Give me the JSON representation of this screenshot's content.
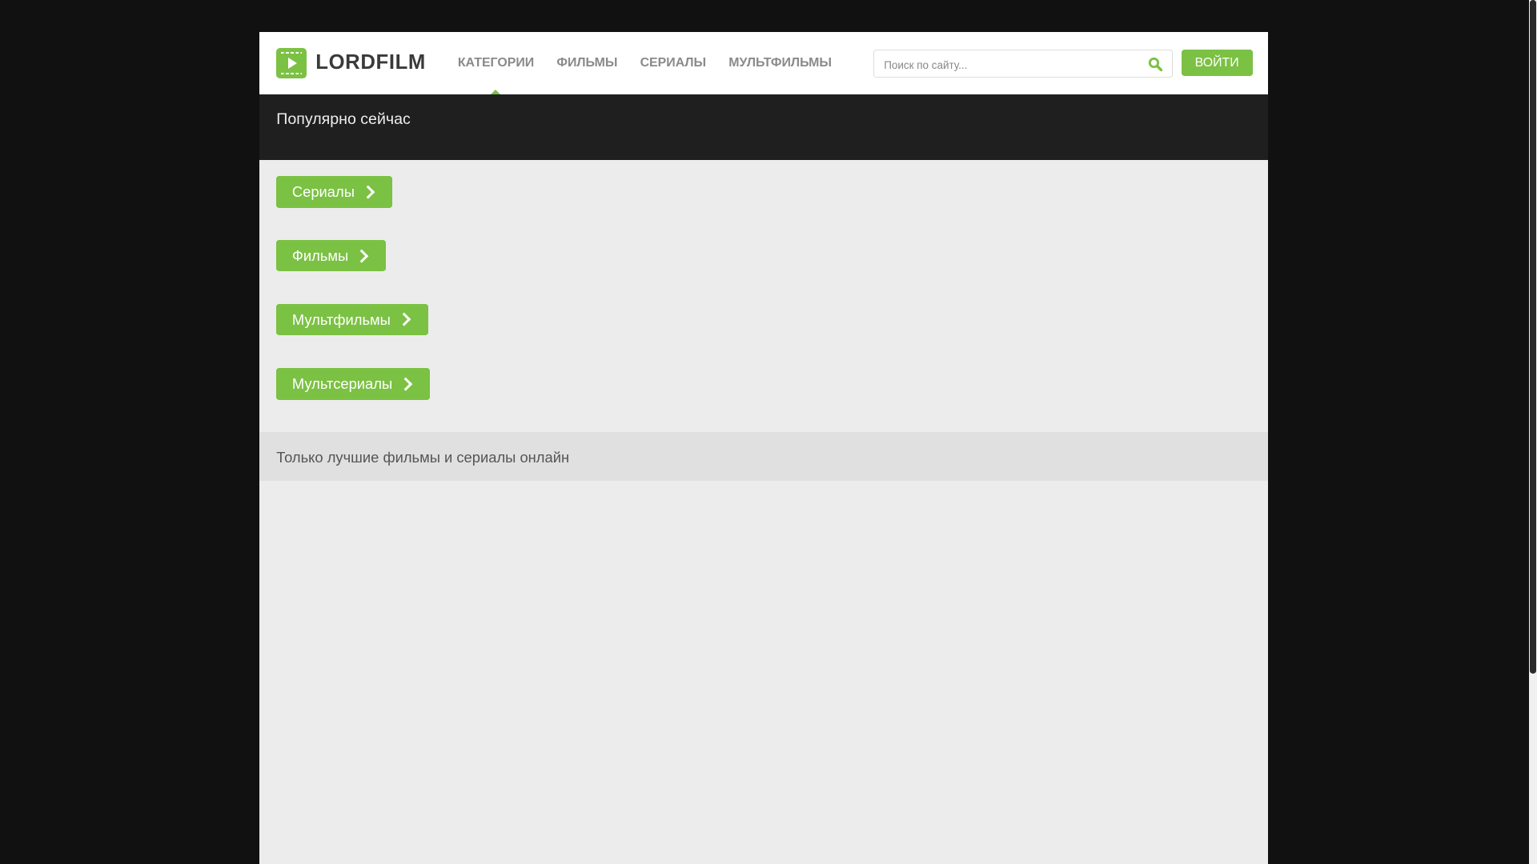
{
  "header": {
    "logo": "LORDFILM",
    "nav": [
      "КАТЕГОРИИ",
      "ФИЛЬМЫ",
      "СЕРИАЛЫ",
      "МУЛЬТФИЛЬМЫ"
    ],
    "search_placeholder": "Поиск по сайту...",
    "login": "ВОЙТИ"
  },
  "popular": {
    "title": "Популярно сейчас"
  },
  "categories": [
    "Сериалы",
    "Фильмы",
    "Мультфильмы",
    "Мультсериалы"
  ],
  "footer": {
    "tagline": "Только лучшие фильмы и сериалы онлайн"
  },
  "colors": {
    "accent": "#7bc143",
    "background": "#111111",
    "band": "#1f1f1f"
  }
}
